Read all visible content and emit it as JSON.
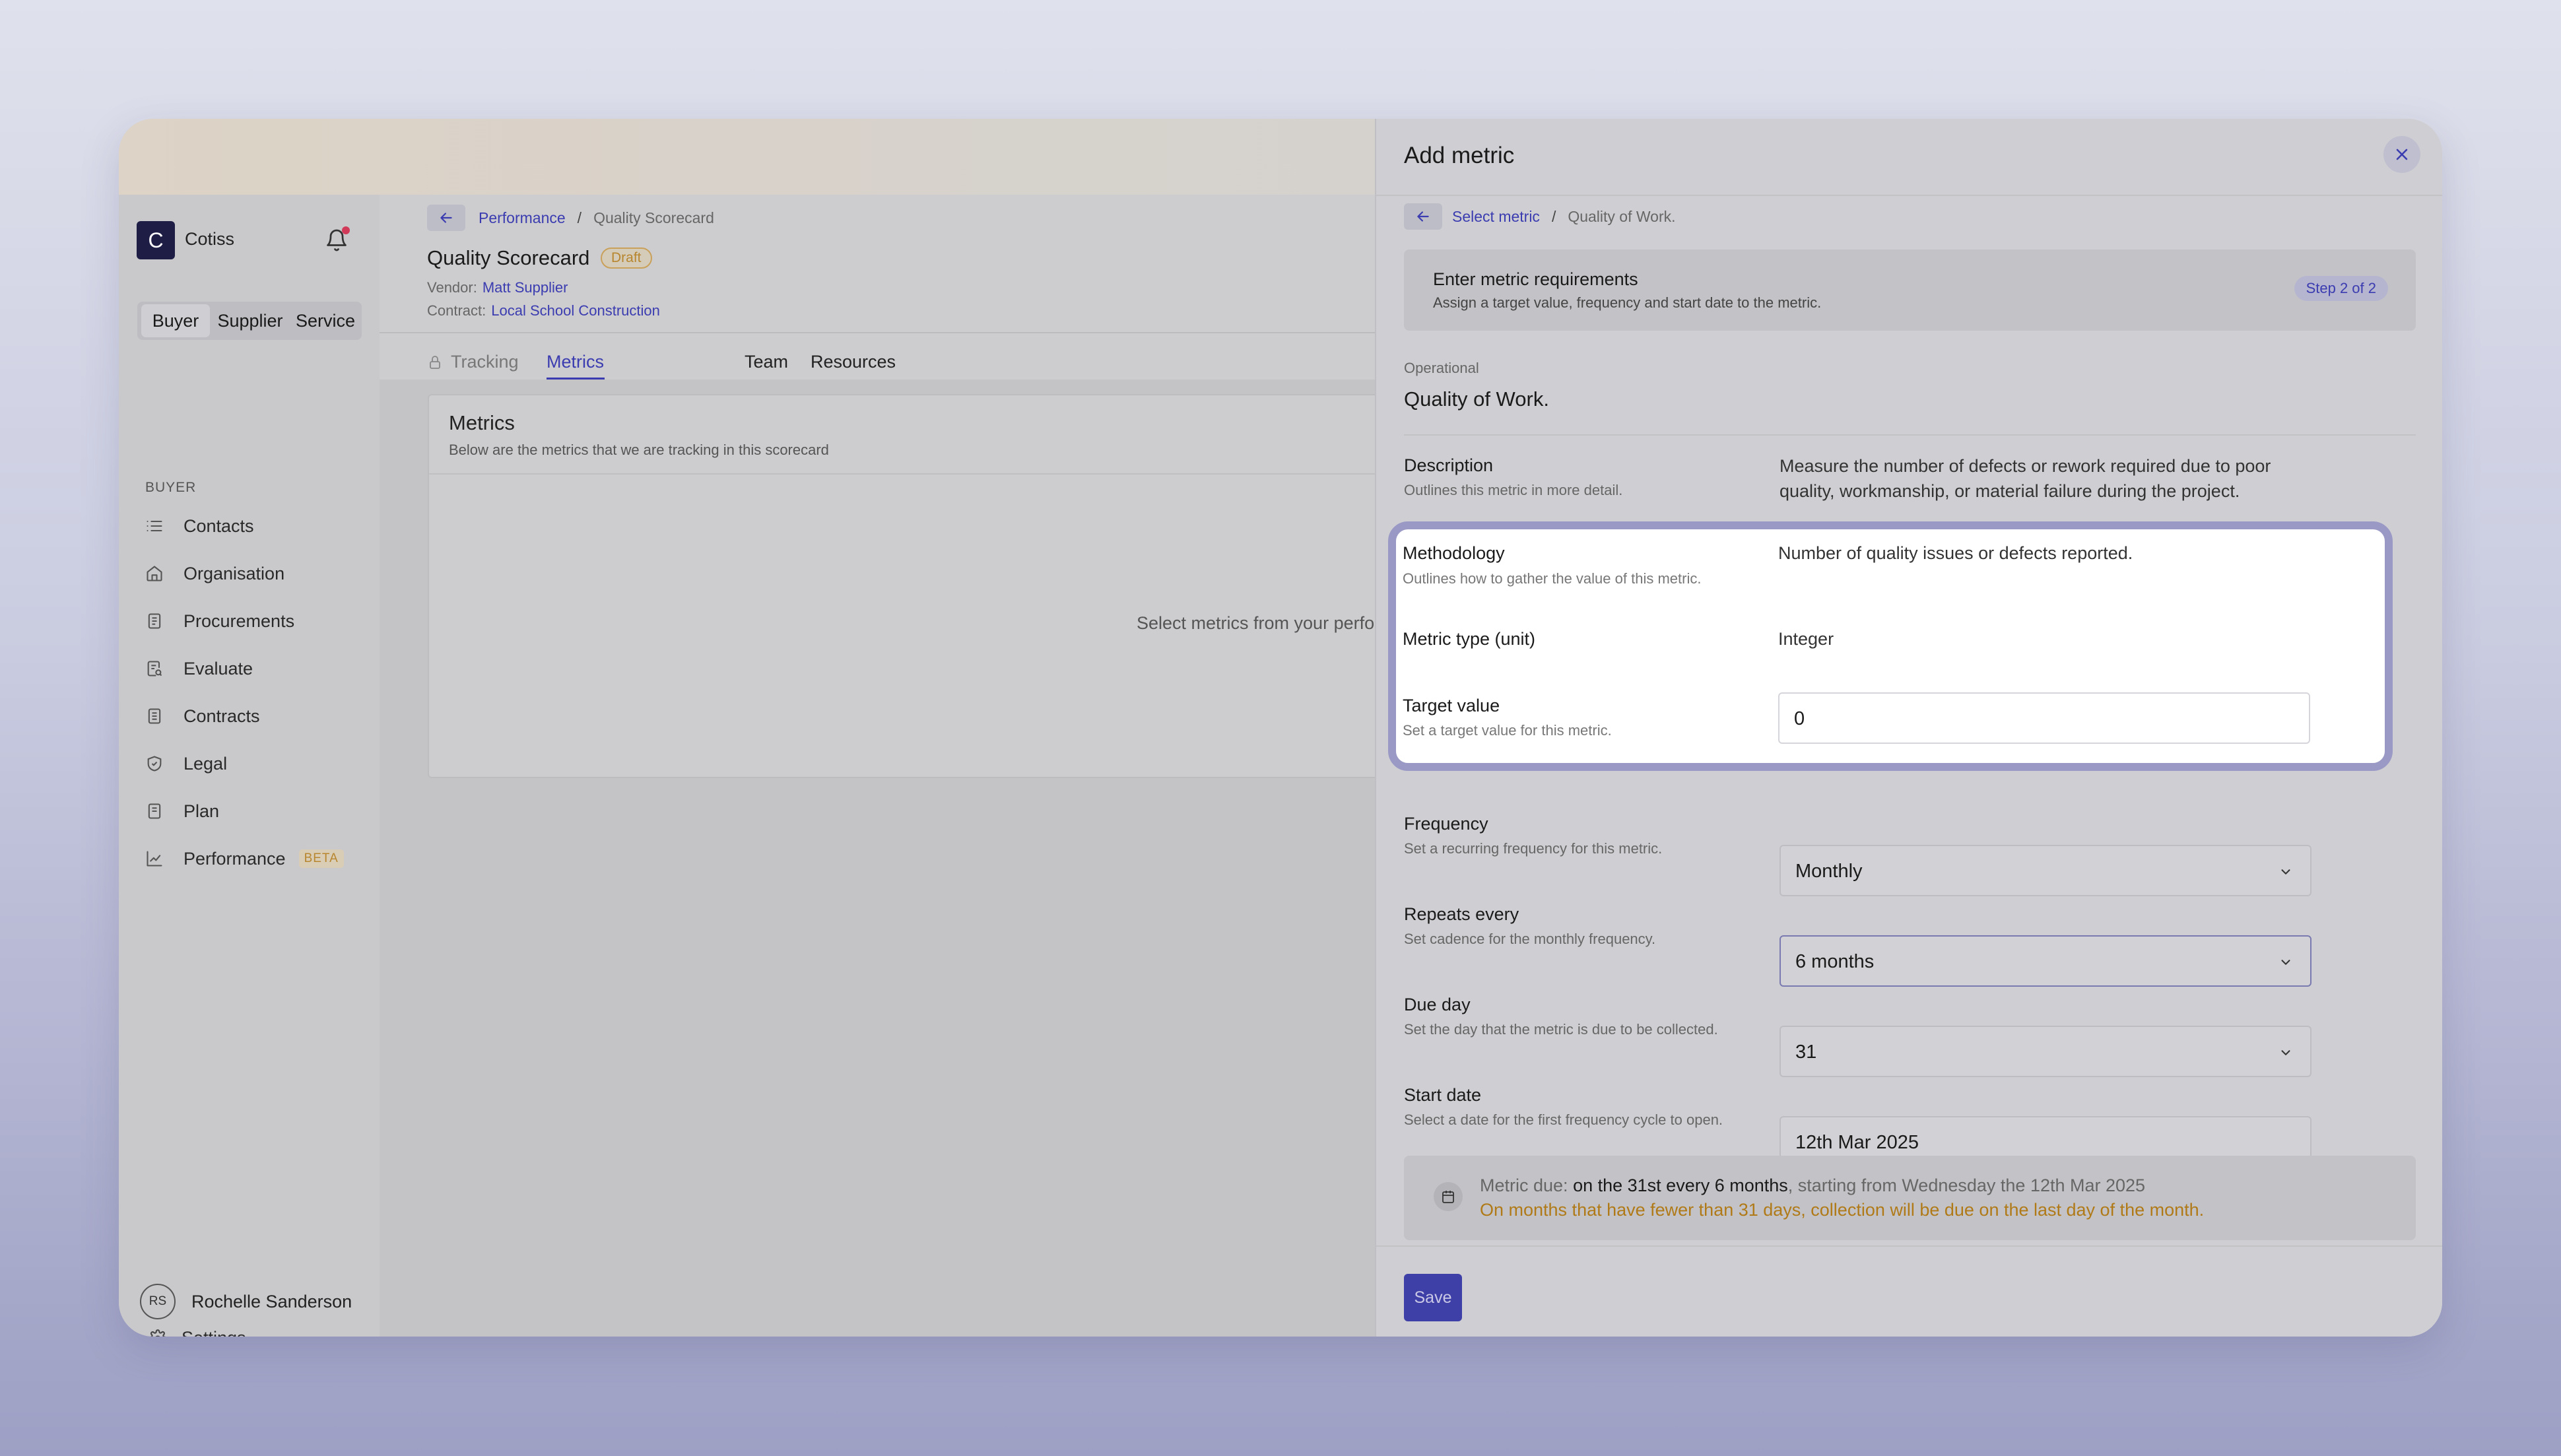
{
  "sidebar": {
    "logo_letter": "C",
    "brand": "Cotiss",
    "roles": [
      "Buyer",
      "Supplier",
      "Service"
    ],
    "section_title": "BUYER",
    "items": [
      {
        "label": "Contacts",
        "icon": "list-icon"
      },
      {
        "label": "Organisation",
        "icon": "home-icon"
      },
      {
        "label": "Procurements",
        "icon": "document-icon"
      },
      {
        "label": "Evaluate",
        "icon": "document-search-icon"
      },
      {
        "label": "Contracts",
        "icon": "contract-icon"
      },
      {
        "label": "Legal",
        "icon": "shield-icon"
      },
      {
        "label": "Plan",
        "icon": "plan-icon"
      },
      {
        "label": "Performance",
        "icon": "chart-line-icon",
        "badge": "BETA"
      }
    ],
    "settings_label": "Settings",
    "user_initials": "RS",
    "user_name": "Rochelle Sanderson"
  },
  "main": {
    "breadcrumb": {
      "link": "Performance",
      "sep": "/",
      "current": "Quality Scorecard"
    },
    "title": "Quality Scorecard",
    "status_badge": "Draft",
    "vendor_label": "Vendor:",
    "vendor_value": "Matt Supplier",
    "contract_label": "Contract:",
    "contract_value": "Local School Construction",
    "tabs": [
      {
        "label": "Tracking"
      },
      {
        "label": "Metrics"
      },
      {
        "label": "Team"
      },
      {
        "label": "Resources"
      }
    ],
    "card": {
      "title": "Metrics",
      "subtitle": "Below are the metrics that we are tracking in this scorecard",
      "empty": "Select metrics from your perfo"
    }
  },
  "drawer": {
    "title": "Add metric",
    "breadcrumb": {
      "link": "Select metric",
      "sep": "/",
      "current": "Quality of Work."
    },
    "step": {
      "title": "Enter metric requirements",
      "subtitle": "Assign a target value, frequency and start date to the metric.",
      "badge": "Step 2 of 2"
    },
    "category": "Operational",
    "metric_name": "Quality of Work.",
    "fields": {
      "description": {
        "label": "Description",
        "help": "Outlines this metric in more detail.",
        "value": "Measure the number of defects or rework required due to poor quality, workmanship, or material failure during the project."
      },
      "methodology": {
        "label": "Methodology",
        "help": "Outlines how to gather the value of this metric.",
        "value": "Number of quality issues or defects reported."
      },
      "metric_type": {
        "label": "Metric type (unit)",
        "value": "Integer"
      },
      "target": {
        "label": "Target value",
        "help": "Set a target value for this metric.",
        "value": "0"
      },
      "frequency": {
        "label": "Frequency",
        "help": "Set a recurring frequency for this metric.",
        "value": "Monthly"
      },
      "repeats": {
        "label": "Repeats every",
        "help": "Set cadence for the monthly frequency.",
        "value": "6 months"
      },
      "due_day": {
        "label": "Due day",
        "help": "Set the day that the metric is due to be collected.",
        "value": "31"
      },
      "start_date": {
        "label": "Start date",
        "help": "Select a date for the first frequency cycle to open.",
        "value": "12th Mar 2025"
      }
    },
    "info": {
      "prefix": "Metric due:",
      "strong": "on the 31st every 6 months",
      "suffix": ", starting from Wednesday the 12th Mar 2025",
      "warning": "On months that have fewer than 31 days, collection will be due on the last day of the month."
    },
    "save_label": "Save"
  }
}
